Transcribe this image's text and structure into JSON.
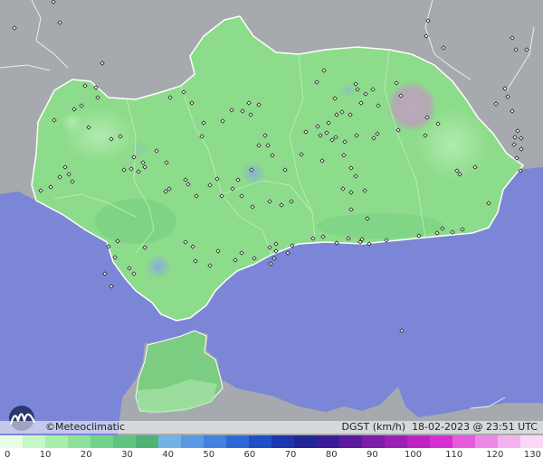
{
  "branding": {
    "name": "©Meteoclimatic"
  },
  "header": {
    "variable": "DGST (km/h)",
    "datetime": "18-02-2023 @ 23:51 UTC"
  },
  "colors": {
    "sea": "#7b86d6",
    "land_outside": "#a6a9ae",
    "region": "#8ddc8b",
    "region_dark": "#6bc27a",
    "station": "#222222",
    "gust_blue": "#8aa5e6",
    "gust_gray": "#b8a8b8"
  },
  "scale": {
    "ticks": [
      "0",
      "10",
      "20",
      "30",
      "40",
      "50",
      "60",
      "70",
      "80",
      "90",
      "100",
      "110",
      "120",
      "130"
    ],
    "colors": [
      "#e9fde6",
      "#c8f6c6",
      "#a9eeaa",
      "#8ee19a",
      "#74d38a",
      "#5ec47f",
      "#4bb476",
      "#74b2e6",
      "#5a9ae2",
      "#4382de",
      "#2d69d6",
      "#1e4fc6",
      "#1d35b1",
      "#212597",
      "#3a1c98",
      "#5d1a9e",
      "#7e1ba7",
      "#9e1fb3",
      "#be22c2",
      "#d82fd2",
      "#e65ade",
      "#ee87e6",
      "#f5b2ef",
      "#fbd8f6"
    ]
  },
  "stations": [
    [
      60,
      133
    ],
    [
      82,
      121
    ],
    [
      90,
      117
    ],
    [
      108,
      108
    ],
    [
      133,
      151
    ],
    [
      153,
      190
    ],
    [
      160,
      185
    ],
    [
      145,
      187
    ],
    [
      66,
      196
    ],
    [
      80,
      201
    ],
    [
      45,
      211
    ],
    [
      56,
      207
    ],
    [
      94,
      95
    ],
    [
      106,
      97
    ],
    [
      188,
      108
    ],
    [
      203,
      102
    ],
    [
      212,
      114
    ],
    [
      225,
      136
    ],
    [
      246,
      134
    ],
    [
      256,
      122
    ],
    [
      275,
      114
    ],
    [
      268,
      123
    ],
    [
      286,
      116
    ],
    [
      277,
      127
    ],
    [
      293,
      150
    ],
    [
      286,
      161
    ],
    [
      296,
      161
    ],
    [
      301,
      172
    ],
    [
      278,
      188
    ],
    [
      263,
      199
    ],
    [
      240,
      198
    ],
    [
      217,
      217
    ],
    [
      183,
      212
    ],
    [
      187,
      209
    ],
    [
      205,
      199
    ],
    [
      232,
      205
    ],
    [
      245,
      217
    ],
    [
      257,
      209
    ],
    [
      267,
      217
    ],
    [
      279,
      229
    ],
    [
      298,
      223
    ],
    [
      311,
      227
    ],
    [
      322,
      223
    ],
    [
      315,
      188
    ],
    [
      333,
      171
    ],
    [
      338,
      146
    ],
    [
      351,
      140
    ],
    [
      354,
      150
    ],
    [
      361,
      147
    ],
    [
      363,
      136
    ],
    [
      367,
      155
    ],
    [
      371,
      152
    ],
    [
      378,
      124
    ],
    [
      372,
      127
    ],
    [
      387,
      127
    ],
    [
      399,
      114
    ],
    [
      404,
      104
    ],
    [
      412,
      99
    ],
    [
      418,
      117
    ],
    [
      417,
      148
    ],
    [
      413,
      153
    ],
    [
      394,
      150
    ],
    [
      381,
      157
    ],
    [
      380,
      172
    ],
    [
      356,
      178
    ],
    [
      388,
      186
    ],
    [
      393,
      195
    ],
    [
      403,
      211
    ],
    [
      388,
      213
    ],
    [
      379,
      209
    ],
    [
      388,
      232
    ],
    [
      346,
      264
    ],
    [
      357,
      262
    ],
    [
      372,
      269
    ],
    [
      385,
      264
    ],
    [
      398,
      268
    ],
    [
      400,
      265
    ],
    [
      408,
      270
    ],
    [
      427,
      266
    ],
    [
      463,
      261
    ],
    [
      483,
      258
    ],
    [
      489,
      253
    ],
    [
      500,
      257
    ],
    [
      511,
      254
    ],
    [
      540,
      225
    ],
    [
      508,
      193
    ],
    [
      505,
      189
    ],
    [
      525,
      185
    ],
    [
      470,
      150
    ],
    [
      484,
      137
    ],
    [
      440,
      144
    ],
    [
      406,
      242
    ],
    [
      318,
      280
    ],
    [
      305,
      270
    ],
    [
      303,
      286
    ],
    [
      298,
      274
    ],
    [
      299,
      292
    ],
    [
      281,
      286
    ],
    [
      267,
      280
    ],
    [
      260,
      288
    ],
    [
      232,
      294
    ],
    [
      241,
      278
    ],
    [
      216,
      289
    ],
    [
      213,
      273
    ],
    [
      205,
      268
    ],
    [
      160,
      274
    ],
    [
      130,
      267
    ],
    [
      127,
      285
    ],
    [
      120,
      273
    ],
    [
      143,
      297
    ],
    [
      148,
      303
    ],
    [
      123,
      317
    ],
    [
      116,
      303
    ],
    [
      223,
      151
    ],
    [
      208,
      204
    ],
    [
      184,
      180
    ],
    [
      173,
      167
    ],
    [
      158,
      180
    ],
    [
      148,
      174
    ],
    [
      137,
      188
    ],
    [
      76,
      193
    ],
    [
      72,
      185
    ],
    [
      123,
      154
    ],
    [
      98,
      141
    ],
    [
      350,
      91
    ],
    [
      393,
      93
    ],
    [
      395,
      99
    ],
    [
      370,
      109
    ],
    [
      358,
      78
    ],
    [
      438,
      92
    ],
    [
      443,
      106
    ],
    [
      472,
      130
    ],
    [
      490,
      53
    ],
    [
      471,
      40
    ],
    [
      473,
      23
    ],
    [
      566,
      42
    ],
    [
      570,
      55
    ],
    [
      582,
      55
    ],
    [
      561,
      107
    ],
    [
      566,
      123
    ],
    [
      568,
      160
    ],
    [
      576,
      153
    ],
    [
      572,
      145
    ],
    [
      576,
      165
    ],
    [
      569,
      152
    ],
    [
      558,
      98
    ],
    [
      548,
      115
    ],
    [
      571,
      175
    ],
    [
      575,
      189
    ],
    [
      444,
      366
    ],
    [
      59,
      2
    ],
    [
      66,
      25
    ],
    [
      113,
      70
    ],
    [
      16,
      31
    ],
    [
      323,
      272
    ],
    [
      305,
      278
    ]
  ]
}
